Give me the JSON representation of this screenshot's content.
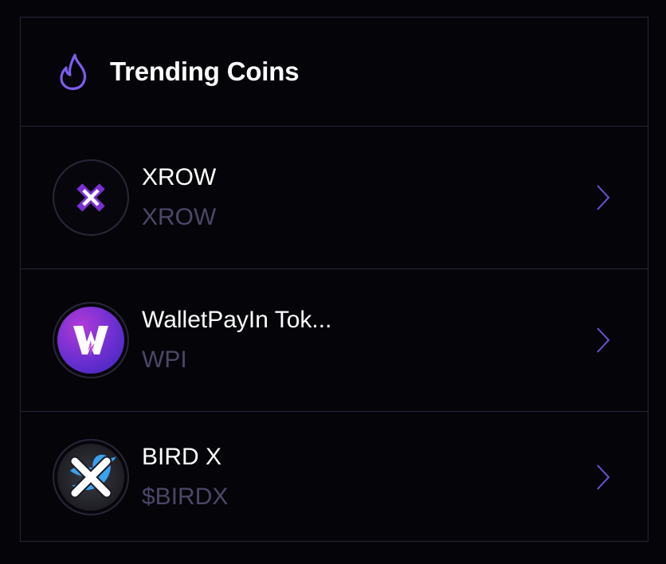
{
  "header": {
    "icon": "flame-icon",
    "title": "Trending Coins"
  },
  "colors": {
    "accent": "#7c5cf0",
    "muted_text": "#4d4668",
    "border": "#2a2638",
    "background": "#050409"
  },
  "coins": [
    {
      "name": "XROW",
      "symbol": "XROW",
      "icon": "xrow-logo-icon"
    },
    {
      "name": "WalletPayIn Tok...",
      "symbol": "WPI",
      "icon": "walletpayin-logo-icon"
    },
    {
      "name": "BIRD X",
      "symbol": "$BIRDX",
      "icon": "birdx-logo-icon"
    }
  ]
}
